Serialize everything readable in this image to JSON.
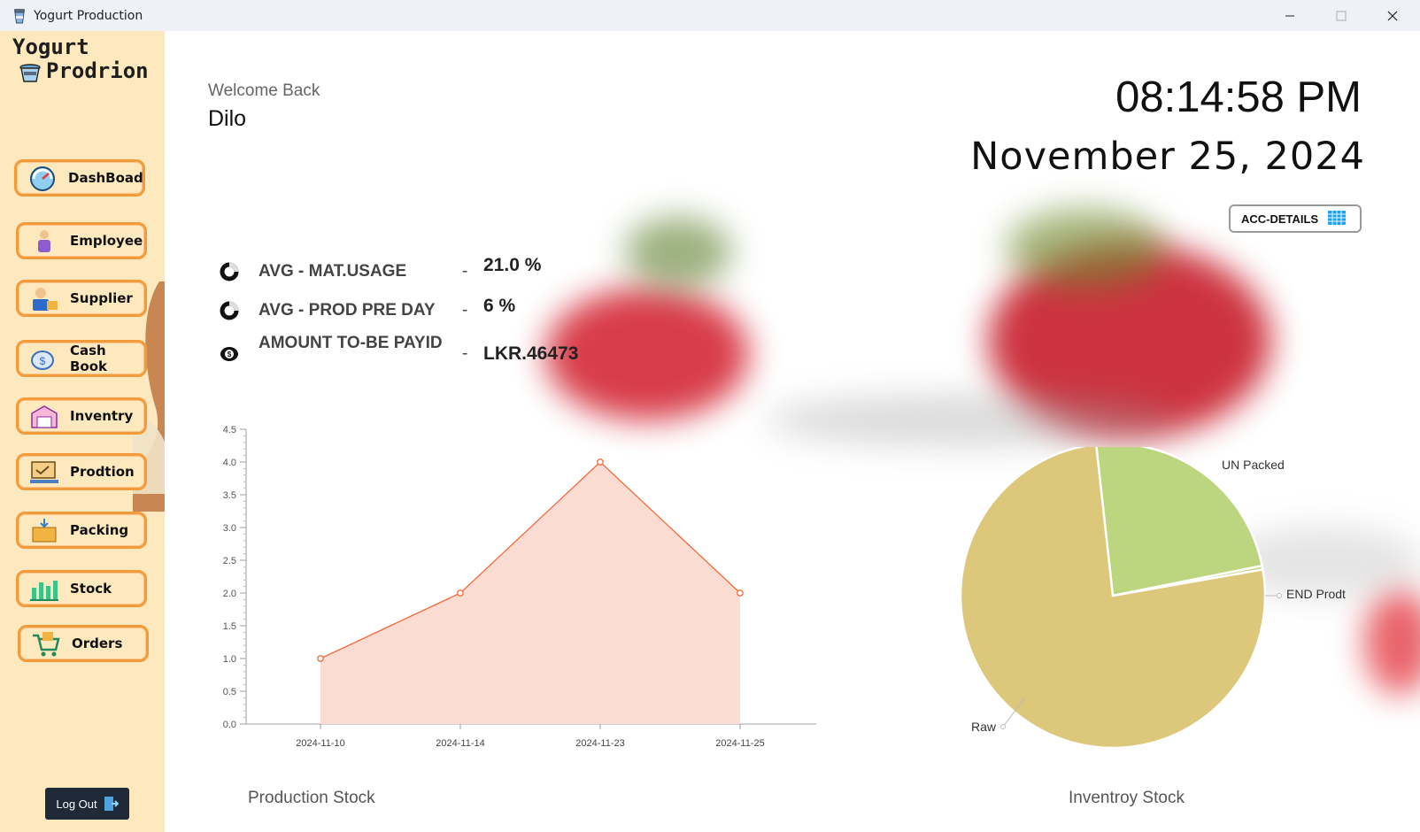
{
  "window": {
    "title": "Yogurt Production"
  },
  "sidebar": {
    "logo_line1": "Yogurt",
    "logo_line2": "Prodrion",
    "items": [
      {
        "label": "DashBoad",
        "icon": "dashboard-gauge-icon"
      },
      {
        "label": "Employee",
        "icon": "employee-person-icon"
      },
      {
        "label": "Supplier",
        "icon": "supplier-delivery-icon"
      },
      {
        "label": "Cash Book",
        "icon": "cash-coins-icon"
      },
      {
        "label": "Inventry",
        "icon": "warehouse-icon"
      },
      {
        "label": "Prodtion",
        "icon": "production-conveyor-icon"
      },
      {
        "label": "Packing",
        "icon": "packing-box-icon"
      },
      {
        "label": "Stock",
        "icon": "stock-bars-icon"
      },
      {
        "label": "Orders",
        "icon": "shopping-cart-icon"
      }
    ],
    "logout_label": "Log Out"
  },
  "header": {
    "welcome": "Welcome Back",
    "username": "Dilo",
    "time": "08:14:58 PM",
    "date": "November 25, 2024",
    "acc_button": "ACC-DETAILS"
  },
  "stats": [
    {
      "label": "AVG - MAT.USAGE",
      "dash": "-",
      "value": "21.0 %"
    },
    {
      "label": "AVG - PROD PRE DAY",
      "dash": "-",
      "value": "6 %"
    },
    {
      "label": "AMOUNT TO-BE PAYID",
      "dash": "-",
      "value": "LKR.46473"
    }
  ],
  "chart_data": [
    {
      "type": "area",
      "title": "Production Stock",
      "categories": [
        "2024-11-10",
        "2024-11-14",
        "2024-11-23",
        "2024-11-25"
      ],
      "values": [
        1.0,
        2.0,
        4.0,
        2.0
      ],
      "ylim": [
        0,
        4.5
      ],
      "yticks": [
        "0.0",
        "0.5",
        "1.0",
        "1.5",
        "2.0",
        "2.5",
        "3.0",
        "3.5",
        "4.0",
        "4.5"
      ],
      "color": "#f26b3a",
      "fill": "#fbdcd2"
    },
    {
      "type": "pie",
      "title": "Inventroy Stock",
      "labels": [
        "UN Packed",
        "END Prodt",
        "Raw"
      ],
      "values": [
        23.6,
        0.4,
        76.0
      ],
      "colors": [
        "#bcd57f",
        "#c9d48b",
        "#dcc77a"
      ]
    }
  ],
  "colors": {
    "sidebar_bg": "#fde9bd",
    "nav_border": "#f39a3a",
    "logout_bg": "#1f2937"
  }
}
